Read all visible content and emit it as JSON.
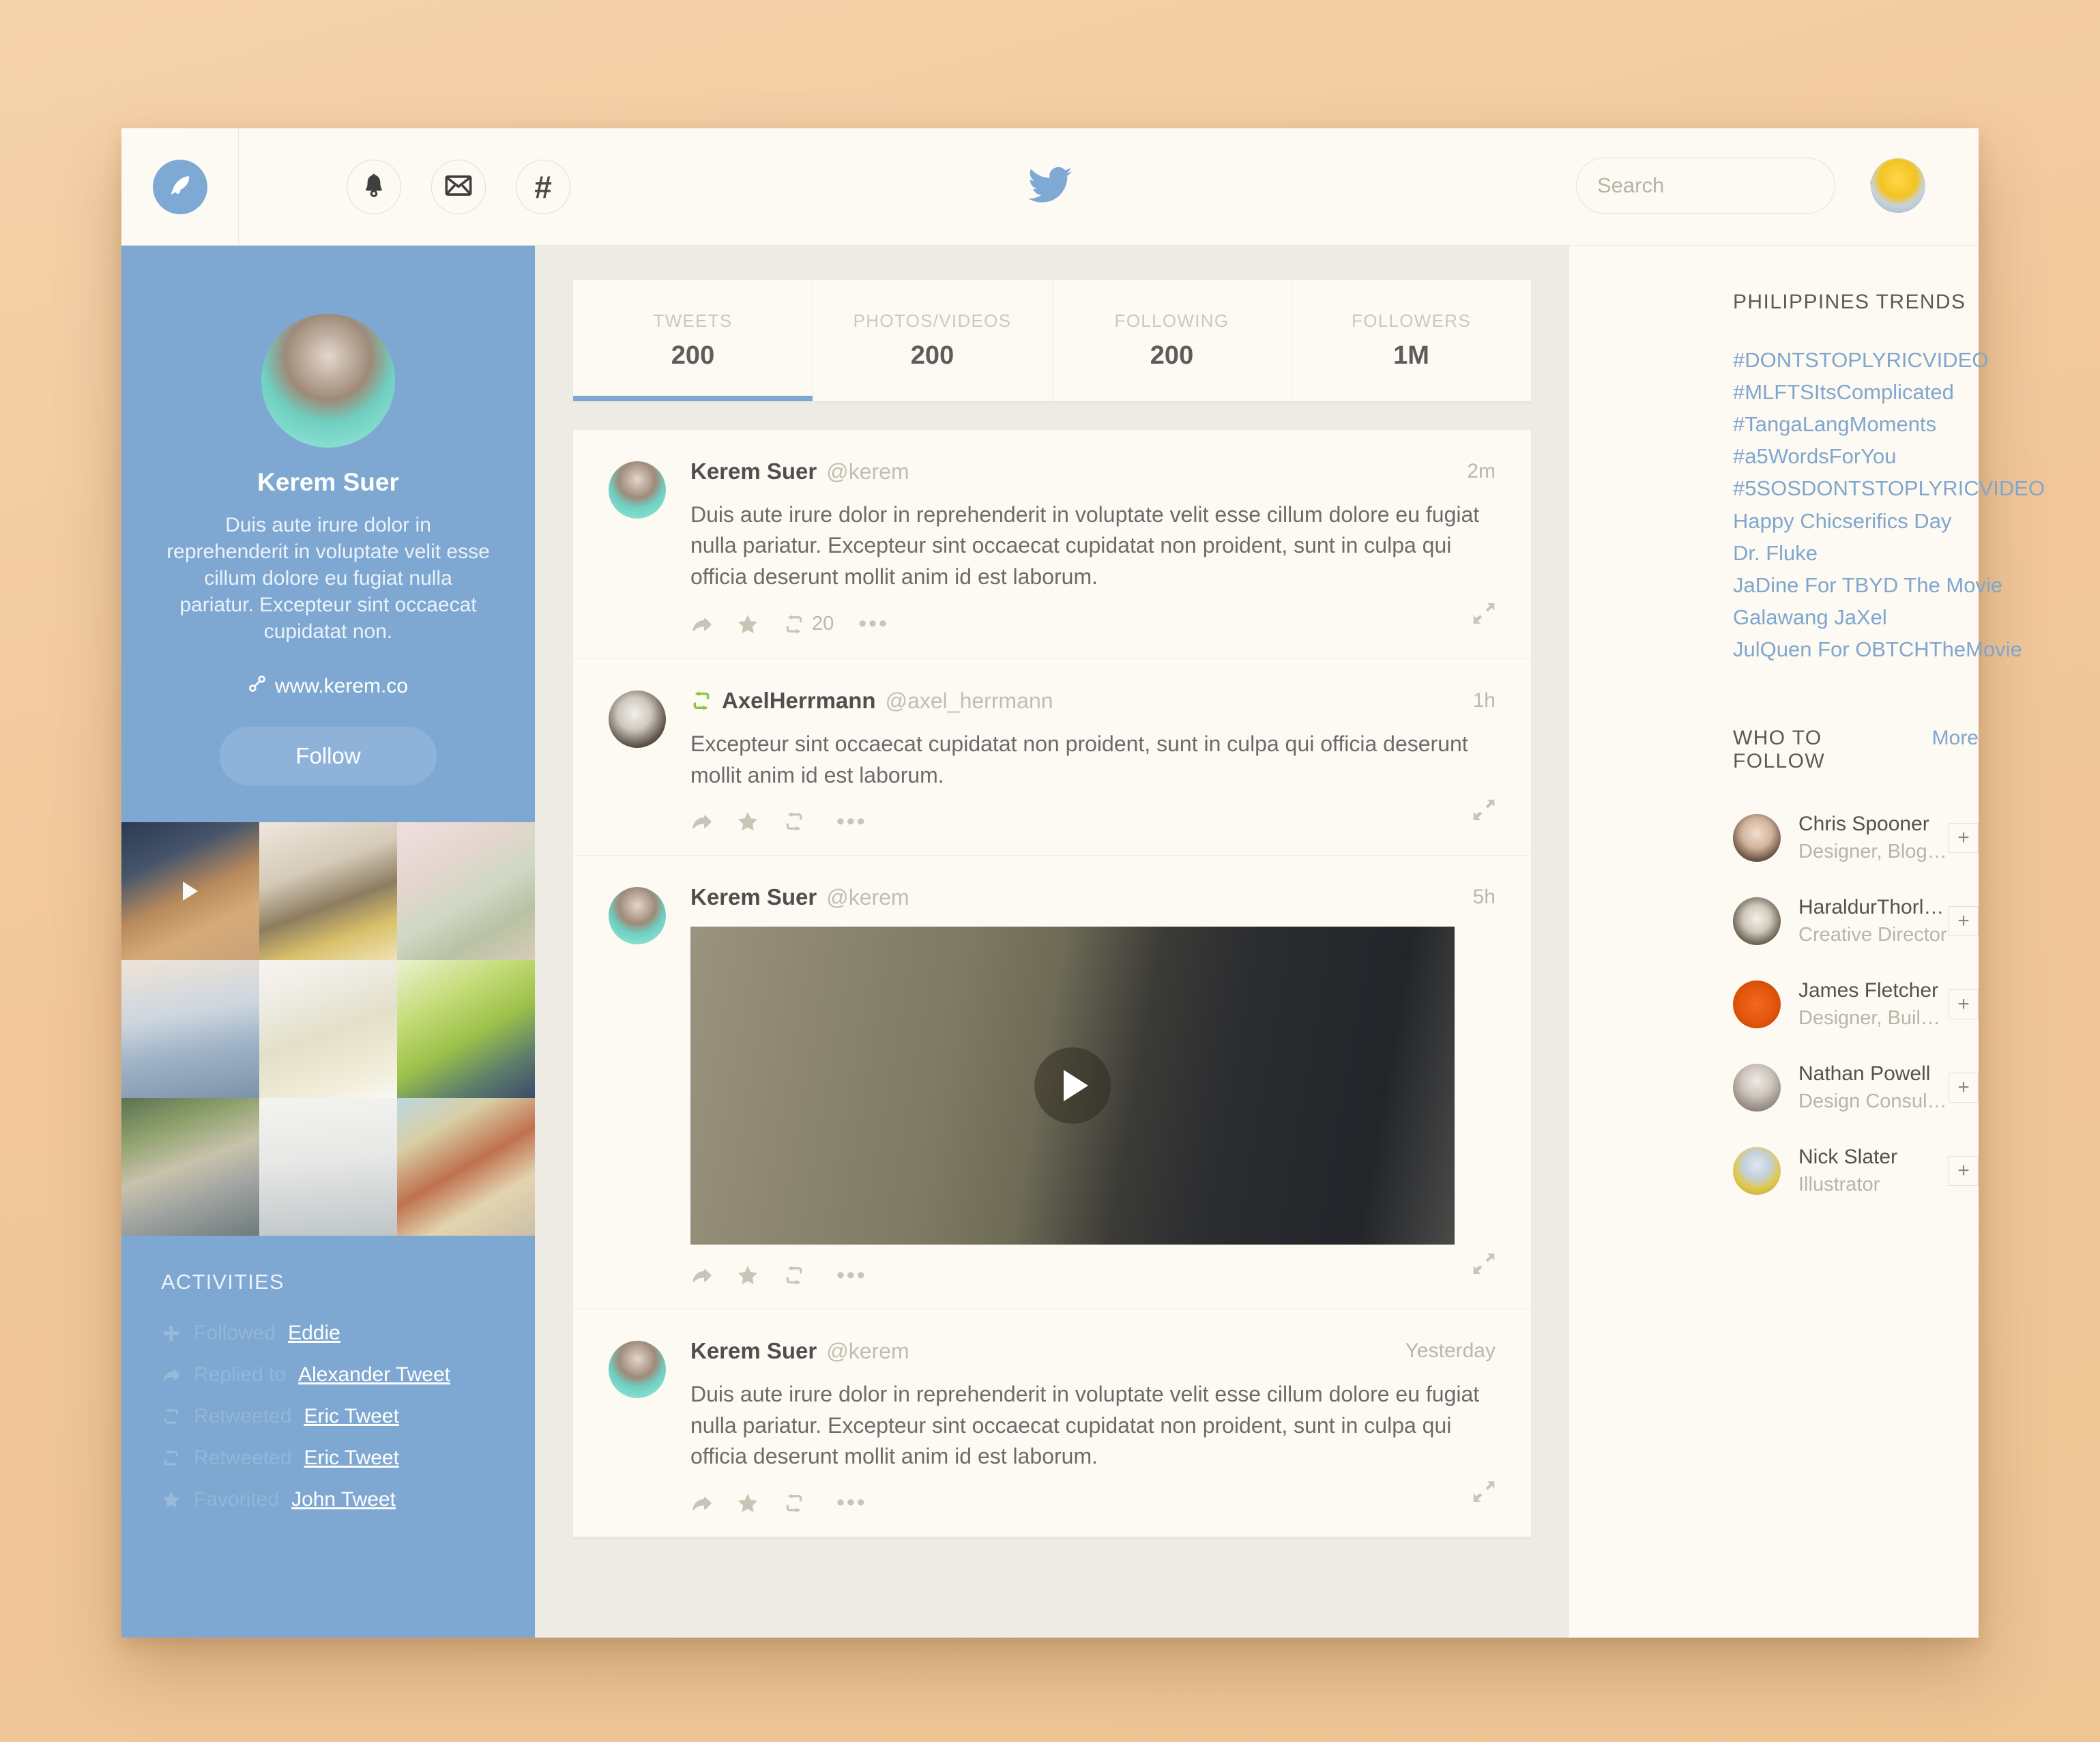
{
  "header": {
    "compose_icon": "feather-quill-icon",
    "nav": [
      {
        "name": "notifications",
        "icon": "bell-icon"
      },
      {
        "name": "messages",
        "icon": "envelope-icon"
      },
      {
        "name": "discover",
        "icon": "hashtag-icon",
        "glyph": "#"
      }
    ],
    "brand_icon": "twitter-bird-logo",
    "search": {
      "placeholder": "Search",
      "value": "",
      "icon": "search-icon"
    },
    "account_avatar": "lego-head-avatar"
  },
  "profile": {
    "avatar": "kerem-suer-avatar",
    "name": "Kerem Suer",
    "bio": "Duis aute irure dolor in reprehenderit in voluptate velit esse cillum dolore eu fugiat nulla pariatur. Excepteur sint occaecat cupidatat non.",
    "link_icon": "link-chain-icon",
    "link": "www.kerem.co",
    "follow_label": "Follow",
    "photos": [
      {
        "name": "boots-video",
        "has_play": true
      },
      {
        "name": "teapot-photo",
        "has_play": false
      },
      {
        "name": "cactus-photo",
        "has_play": false
      },
      {
        "name": "chair-window-photo",
        "has_play": false
      },
      {
        "name": "lemon-tea-bowl-photo",
        "has_play": false
      },
      {
        "name": "green-leaf-photo",
        "has_play": false
      },
      {
        "name": "man-on-railing-photo",
        "has_play": false
      },
      {
        "name": "misty-sea-photo",
        "has_play": false
      },
      {
        "name": "laundry-street-photo",
        "has_play": false
      }
    ],
    "activities_title": "ACTIVITIES",
    "activities": [
      {
        "icon": "plus-icon",
        "verb": "Followed",
        "target": "Eddie"
      },
      {
        "icon": "reply-arrow-icon",
        "verb": "Replied to",
        "target": "Alexander Tweet"
      },
      {
        "icon": "retweet-icon",
        "verb": "Retweeted",
        "target": "Eric Tweet"
      },
      {
        "icon": "retweet-icon",
        "verb": "Retweeted",
        "target": "Eric Tweet"
      },
      {
        "icon": "star-icon",
        "verb": "Favorited",
        "target": "John Tweet"
      }
    ]
  },
  "stats": [
    {
      "label": "TWEETS",
      "value": "200",
      "active": true
    },
    {
      "label": "PHOTOS/VIDEOS",
      "value": "200",
      "active": false
    },
    {
      "label": "FOLLOWING",
      "value": "200",
      "active": false
    },
    {
      "label": "FOLLOWERS",
      "value": "1M",
      "active": false
    }
  ],
  "tweets": [
    {
      "avatar": "kerem-suer-avatar",
      "name": "Kerem Suer",
      "handle": "@kerem",
      "time": "2m",
      "retweeted_badge": false,
      "text": "Duis aute irure dolor in reprehenderit in voluptate velit esse cillum dolore eu fugiat nulla pariatur. Excepteur sint occaecat cupidatat non proident, sunt in culpa qui officia deserunt mollit anim id est laborum.",
      "media": null,
      "retweet_count": "20",
      "dots": "•••"
    },
    {
      "avatar": "axel-herrmann-avatar",
      "name": "AxelHerrmann",
      "handle": "@axel_herrmann",
      "time": "1h",
      "retweeted_badge": true,
      "text": "Excepteur sint occaecat cupidatat non proident, sunt in culpa qui officia deserunt mollit anim id est laborum.",
      "media": null,
      "retweet_count": "",
      "dots": "•••"
    },
    {
      "avatar": "kerem-suer-avatar",
      "name": "Kerem Suer",
      "handle": "@kerem",
      "time": "5h",
      "retweeted_badge": false,
      "text": "",
      "media": {
        "type": "video",
        "name": "forest-boots-video",
        "play_icon": "play-icon"
      },
      "retweet_count": "",
      "dots": "•••"
    },
    {
      "avatar": "kerem-suer-avatar",
      "name": "Kerem Suer",
      "handle": "@kerem",
      "time": "Yesterday",
      "retweeted_badge": false,
      "text": "Duis aute irure dolor in reprehenderit in voluptate velit esse cillum dolore eu fugiat nulla pariatur. Excepteur sint occaecat cupidatat non proident, sunt in culpa qui officia deserunt mollit anim id est laborum.",
      "media": null,
      "retweet_count": "",
      "dots": "•••"
    }
  ],
  "trends": {
    "title": "PHILIPPINES TRENDS",
    "items": [
      "#DONTSTOPLYRICVIDEO",
      "#MLFTSItsComplicated",
      "#TangaLangMoments",
      "#a5WordsForYou",
      "#5SOSDONTSTOPLYRICVIDEO",
      "Happy Chicserifics Day",
      "Dr. Fluke",
      "JaDine For TBYD The Movie",
      "Galawang JaXel",
      "JulQuen For OBTCHTheMovie"
    ]
  },
  "who_to_follow": {
    "title": "WHO TO FOLLOW",
    "more_label": "More",
    "add_label": "+",
    "people": [
      {
        "avatar": "chris-spooner-avatar",
        "name": "Chris Spooner",
        "role": "Designer, Blogger"
      },
      {
        "avatar": "haraldur-thorleifsson-avatar",
        "name": "HaraldurThorleifs...",
        "role": "Creative Director"
      },
      {
        "avatar": "ux-booth-avatar",
        "name": "James Fletcher",
        "role": "Designer, Builder..."
      },
      {
        "avatar": "nathan-powell-avatar",
        "name": "Nathan Powell",
        "role": "Design Consultant"
      },
      {
        "avatar": "nick-slater-avatar",
        "name": "Nick Slater",
        "role": "Illustrator"
      }
    ]
  },
  "colors": {
    "desktop_bg": "#f1c79a",
    "panel_bg": "#fdfaf3",
    "sidebar_blue": "#7ea8d1",
    "accent_blue": "#7da9d4",
    "link_blue": "#80a6cd",
    "retweet_green": "#8cc63f",
    "center_bg": "#eeebe4"
  }
}
